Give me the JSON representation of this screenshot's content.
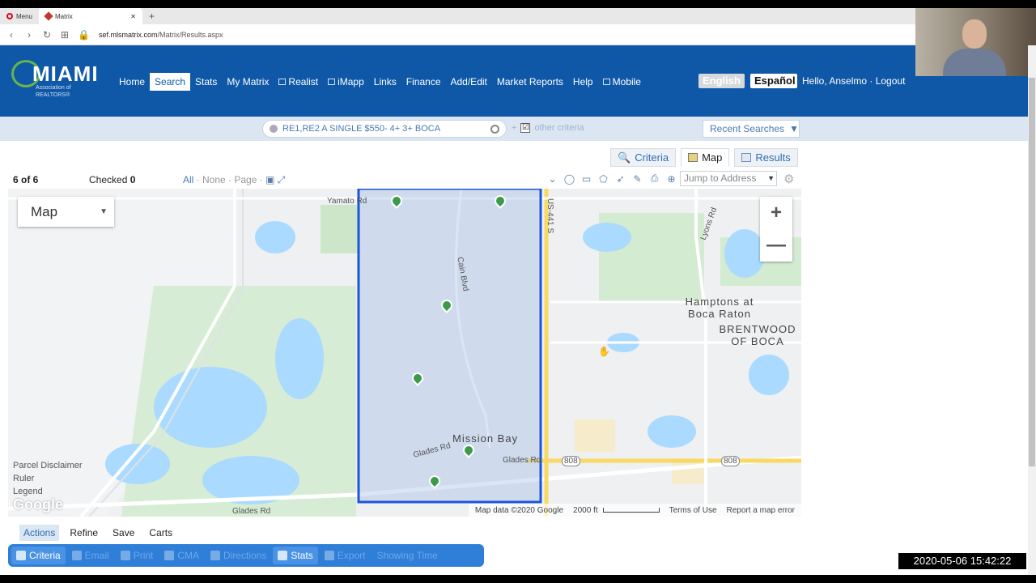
{
  "browser": {
    "opera_tab": "Menu",
    "active_tab": "Matrix",
    "url_host": "sef.mlsmatrix.com",
    "url_path": "/Matrix/Results.aspx"
  },
  "logo": {
    "title": "MIAMI",
    "subtitle": "Association of REALTORS®"
  },
  "nav": [
    "Home",
    "Search",
    "Stats",
    "My Matrix",
    "Realist",
    "iMapp",
    "Links",
    "Finance",
    "Add/Edit",
    "Market Reports",
    "Help",
    "Mobile"
  ],
  "lang": {
    "en": "English",
    "es": "Español"
  },
  "user": {
    "hello": "Hello, Anselmo · Logout"
  },
  "search": {
    "query": "RE1,RE2 A SINGLE $550- 4+ 3+ BOCA",
    "other_criteria": "other criteria",
    "checkmark": "☑",
    "recent": "Recent Searches"
  },
  "viewtabs": {
    "criteria": "Criteria",
    "map": "Map",
    "results": "Results"
  },
  "toolbar": {
    "count": "6 of 6",
    "checked_label": "Checked",
    "checked_count": "0",
    "all": "All",
    "none": "None",
    "page": "Page",
    "jump": "Jump to Address"
  },
  "map": {
    "type": "Map",
    "zoom_in": "+",
    "zoom_out": "—",
    "labels": {
      "yamato": "Yamato Rd",
      "cain": "Cain Blvd",
      "us441": "US-441 S",
      "lyons": "Lyons Rd",
      "hamptons": "Hamptons at Boca Raton",
      "brentwood": "BRENTWOOD OF BOCA",
      "mission": "Mission Bay",
      "glades1": "Glades Rd",
      "glades2": "Glades Rd",
      "glades3": "Glades Rd",
      "r808a": "808",
      "r808b": "808"
    },
    "parcel": "Parcel Disclaimer",
    "ruler": "Ruler",
    "legend": "Legend",
    "google": "Google",
    "attribution": "Map data ©2020 Google",
    "scale": "2000 ft",
    "terms": "Terms of Use",
    "report": "Report a map error"
  },
  "actions": {
    "tabs": [
      "Actions",
      "Refine",
      "Save",
      "Carts"
    ],
    "buttons": [
      "Criteria",
      "Email",
      "Print",
      "CMA",
      "Directions",
      "Stats",
      "Export",
      "Showing Time"
    ]
  },
  "timestamp": "2020-05-06  15:42:22",
  "colors": {
    "header": "#0f58a8",
    "polygon": "#1a56db",
    "accent": "#2f7fd9",
    "pin": "#3c9a4a"
  }
}
